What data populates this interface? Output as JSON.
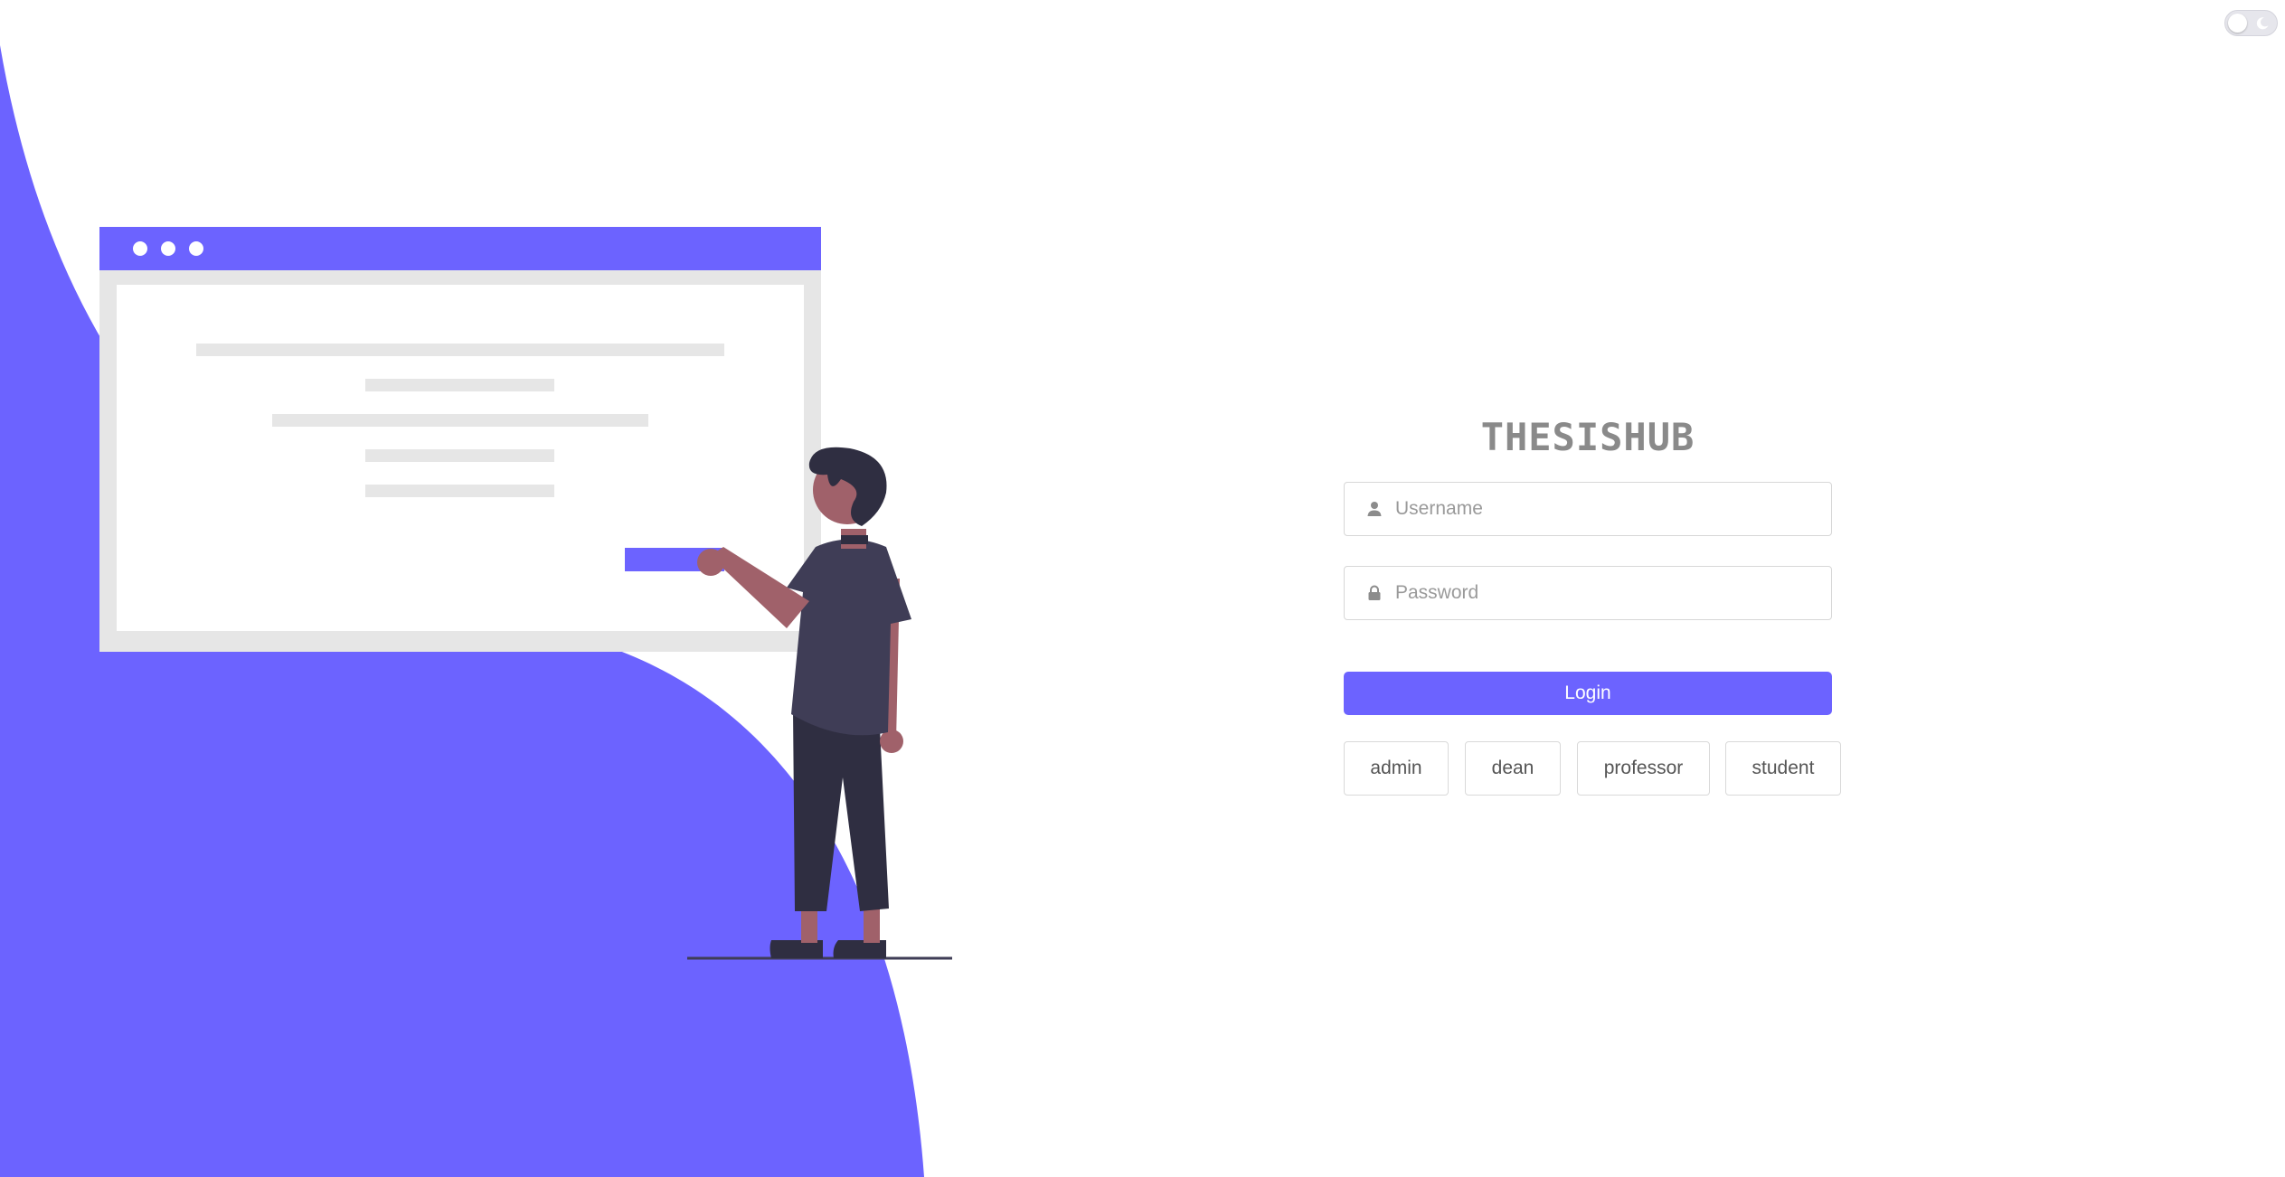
{
  "brand": {
    "title": "THESISHUB"
  },
  "login_form": {
    "username_placeholder": "Username",
    "password_placeholder": "Password",
    "login_label": "Login"
  },
  "quick_roles": [
    {
      "label": "admin"
    },
    {
      "label": "dean"
    },
    {
      "label": "professor"
    },
    {
      "label": "student"
    }
  ],
  "theme_toggle": {
    "state": "light",
    "icon": "moon-icon"
  },
  "colors": {
    "accent": "#6c63ff",
    "brand_text": "#8a8a8a",
    "illustration_gray": "#e6e6e6",
    "person_dark": "#2f2e41",
    "person_shirt": "#3f3d56",
    "person_skin": "#a0616a"
  }
}
